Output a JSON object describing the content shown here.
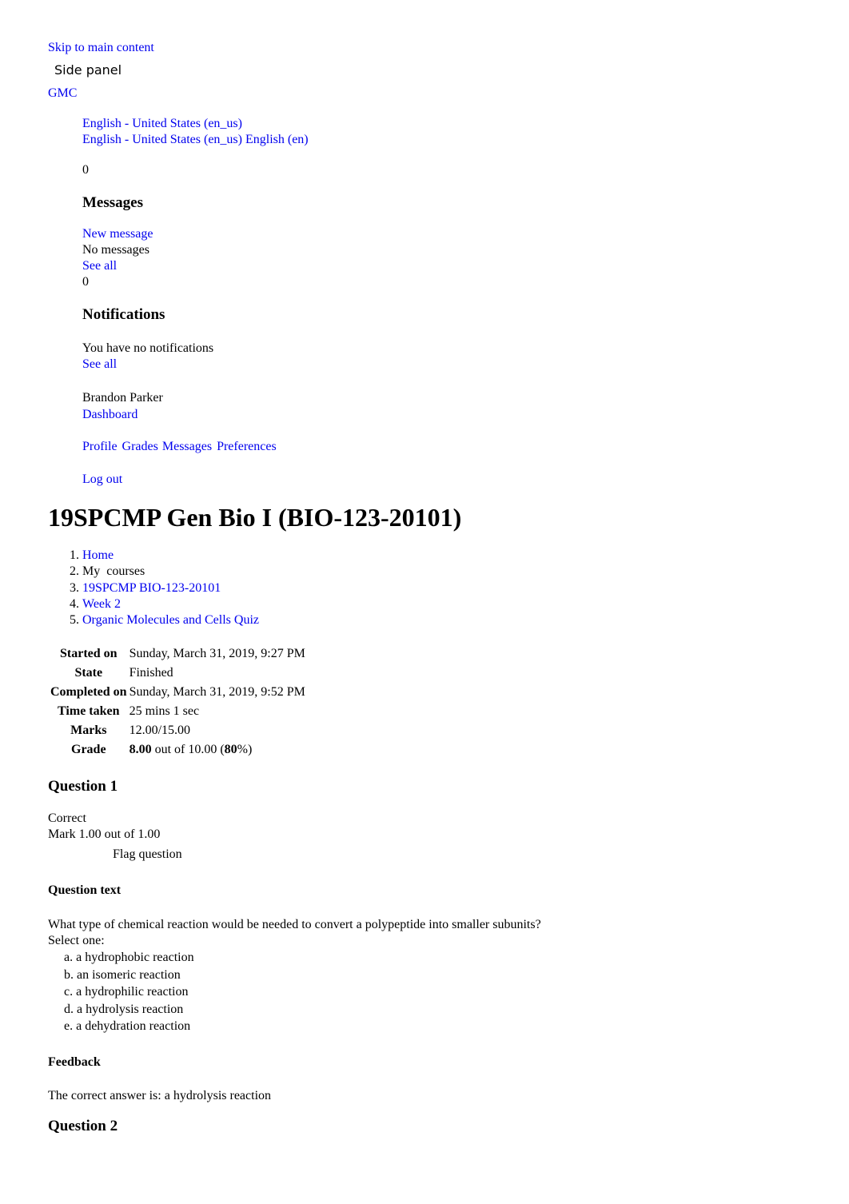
{
  "skip_link": "Skip to main content",
  "side_panel": "Side panel",
  "site_name": "GMC",
  "language": {
    "current": "English - United States (en_us)",
    "options": [
      "English - United States (en_us)",
      "English (en)"
    ]
  },
  "messages": {
    "count": "0",
    "heading": "Messages",
    "new_message": "New message",
    "empty_text": "No messages",
    "see_all": "See all"
  },
  "notifications": {
    "count": "0",
    "heading": "Notifications",
    "empty_text": "You have no notifications",
    "see_all": "See all"
  },
  "user": {
    "name": "Brandon Parker",
    "dashboard": "Dashboard",
    "links": [
      "Profile",
      "Grades",
      "Messages",
      "Preferences"
    ],
    "logout": "Log out"
  },
  "course_title": "19SPCMP Gen Bio I (BIO-123-20101)",
  "breadcrumb": [
    {
      "label": "Home",
      "link": true
    },
    {
      "label": "My courses",
      "link": false
    },
    {
      "label": "19SPCMP BIO-123-20101",
      "link": true
    },
    {
      "label": "Week 2",
      "link": true
    },
    {
      "label": "Organic Molecules and Cells Quiz",
      "link": true
    }
  ],
  "summary": {
    "rows": [
      {
        "label": "Started on",
        "value": "Sunday, March 31, 2019, 9:27 PM"
      },
      {
        "label": "State",
        "value": "Finished"
      },
      {
        "label": "Completed on",
        "value": "Sunday, March 31, 2019, 9:52 PM"
      },
      {
        "label": "Time taken",
        "value": "25 mins 1 sec"
      },
      {
        "label": "Marks",
        "value": "12.00/15.00"
      }
    ],
    "grade": {
      "label": "Grade",
      "score": "8.00",
      "out_of_text": " out of 10.00 (",
      "percent": "80",
      "suffix": "%)"
    }
  },
  "question1": {
    "heading": "Question 1",
    "state": "Correct",
    "mark": "Mark 1.00 out of 1.00",
    "flag": "Flag question",
    "text_heading": "Question text",
    "text": "What type of chemical reaction would be needed to convert a polypeptide into smaller subunits?",
    "prompt": "Select one:",
    "answers": [
      "a. a hydrophobic reaction",
      "b. an isomeric reaction",
      "c. a hydrophilic reaction",
      "d. a hydrolysis reaction",
      "e. a dehydration reaction"
    ],
    "feedback_heading": "Feedback",
    "feedback": "The correct answer is: a hydrolysis reaction"
  },
  "question2": {
    "heading": "Question 2"
  }
}
